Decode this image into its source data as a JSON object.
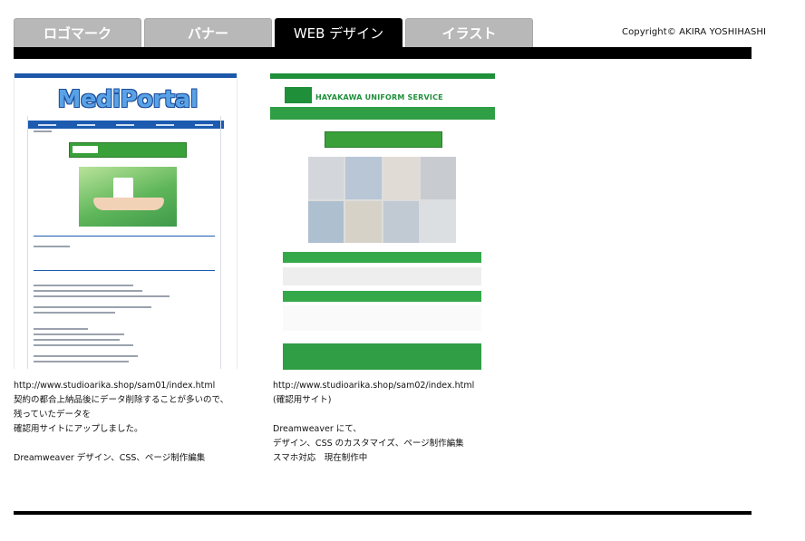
{
  "tabs": [
    {
      "label": "ロゴマーク"
    },
    {
      "label": "バナー"
    },
    {
      "label": "WEB デザイン",
      "active": true
    },
    {
      "label": "イラスト"
    }
  ],
  "copyright": "Copyright© AKIRA YOSHIHASHI",
  "works": [
    {
      "thumbnail": {
        "logo_text": "MediPortal"
      },
      "caption": [
        "http://www.studioarika.shop/sam01/index.html",
        "契約の都合上納品後にデータ削除することが多いので、",
        "残っていたデータを",
        "確認用サイトにアップしました。",
        "",
        "Dreamweaver デザイン、CSS、ページ制作編集"
      ]
    },
    {
      "thumbnail": {
        "logo_text": "HAYAKAWA UNIFORM SERVICE"
      },
      "caption": [
        "http://www.studioarika.shop/sam02/index.html",
        "(確認用サイト)",
        "",
        "Dreamweaver にて、",
        "デザイン、CSS のカスタマイズ、ページ制作編集",
        "スマホ対応　現在制作中"
      ]
    }
  ],
  "colors": {
    "tab_inactive": "#b8b8b8",
    "tab_active": "#000000",
    "mediportal_blue": "#1d57a8",
    "hayakawa_green": "#2f9e44"
  }
}
